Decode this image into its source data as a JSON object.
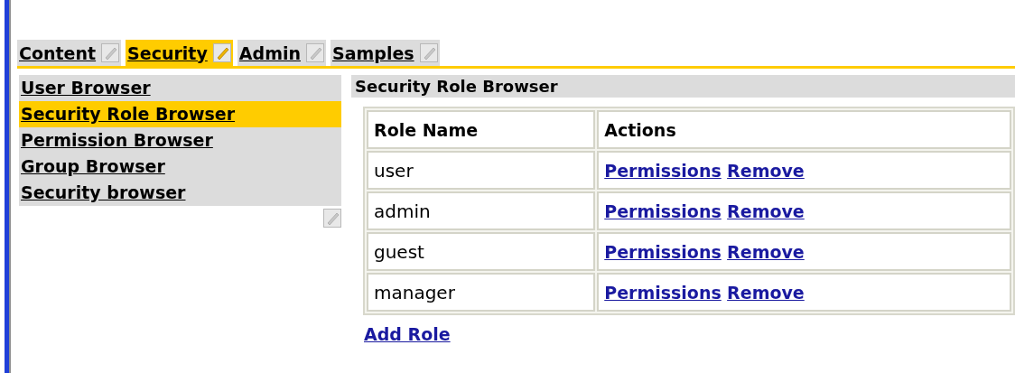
{
  "tabs": [
    {
      "label": "Content",
      "selected": false
    },
    {
      "label": "Security",
      "selected": true
    },
    {
      "label": "Admin",
      "selected": false
    },
    {
      "label": "Samples",
      "selected": false
    }
  ],
  "sidebar": {
    "items": [
      {
        "label": "User Browser",
        "selected": false
      },
      {
        "label": "Security Role Browser",
        "selected": true
      },
      {
        "label": "Permission Browser",
        "selected": false
      },
      {
        "label": "Group Browser",
        "selected": false
      },
      {
        "label": "Security browser",
        "selected": false
      }
    ]
  },
  "panel": {
    "title": "Security Role Browser",
    "table": {
      "columns": [
        "Role Name",
        "Actions"
      ],
      "rows": [
        {
          "role": "user",
          "actions": [
            "Permissions",
            "Remove"
          ]
        },
        {
          "role": "admin",
          "actions": [
            "Permissions",
            "Remove"
          ]
        },
        {
          "role": "guest",
          "actions": [
            "Permissions",
            "Remove"
          ]
        },
        {
          "role": "manager",
          "actions": [
            "Permissions",
            "Remove"
          ]
        }
      ]
    },
    "link": "Add Role"
  }
}
